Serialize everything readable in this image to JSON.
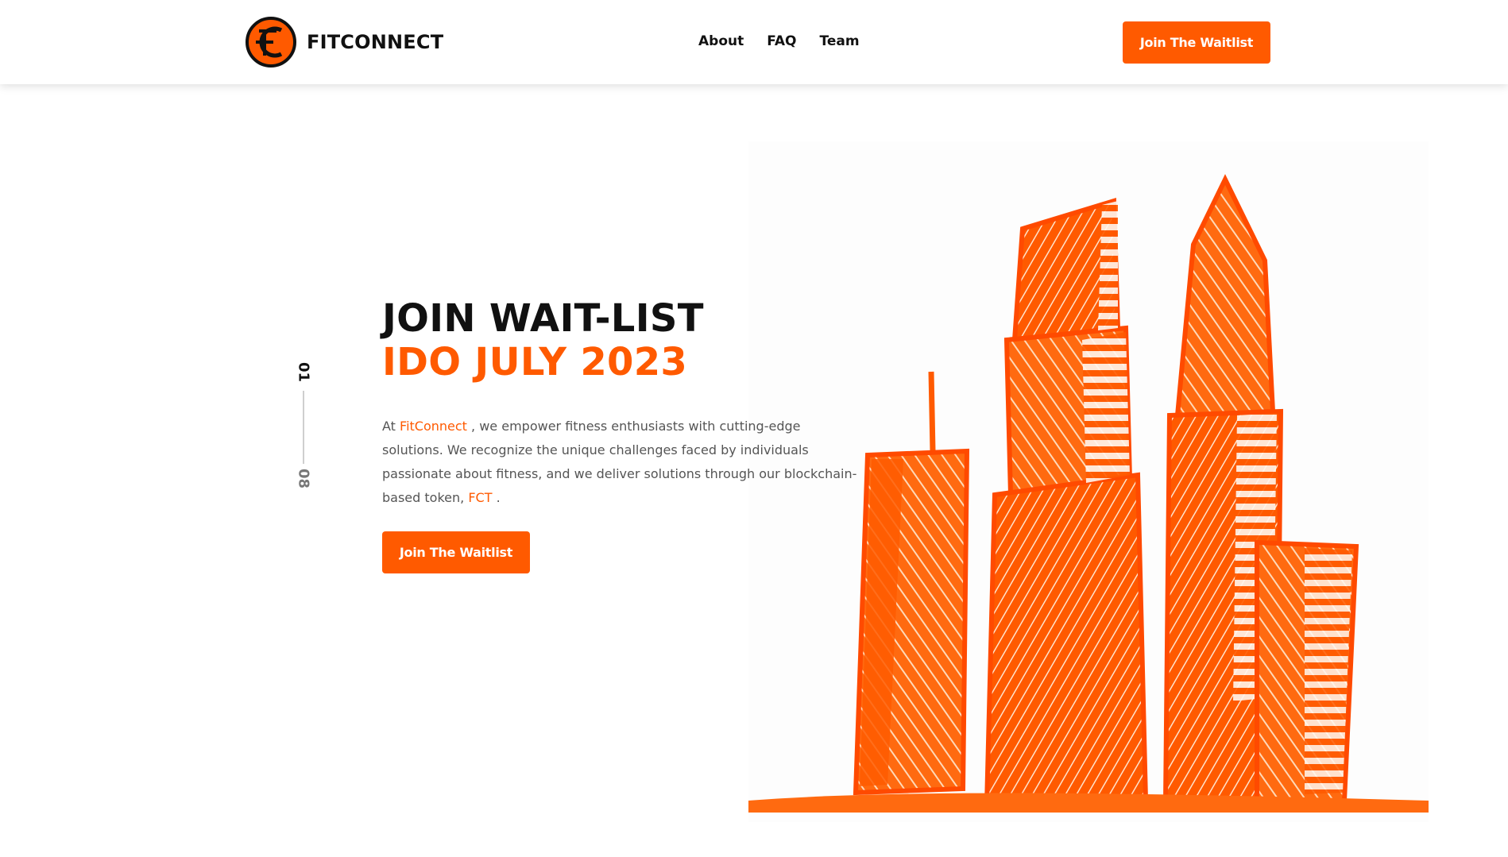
{
  "brand": {
    "logo_text": "FITCONNECT",
    "icon": "fc-logo-icon"
  },
  "nav": {
    "items": [
      {
        "label": "About"
      },
      {
        "label": "FAQ"
      },
      {
        "label": "Team"
      }
    ]
  },
  "header": {
    "cta_label": "Join The Waitlist"
  },
  "slider": {
    "current": "01",
    "total": "08"
  },
  "hero": {
    "title": "JOIN WAIT-LIST",
    "subtitle": "IDO JULY 2023",
    "description": {
      "prefix": "At",
      "brand_link": "FitConnect",
      "body": ", we empower fitness enthusiasts with cutting-edge solutions. We recognize the unique challenges faced by individuals passionate about fitness, and we deliver solutions through our blockchain-based token,",
      "token_link": "FCT",
      "suffix": "."
    },
    "cta_label": "Join The Waitlist",
    "image": "orange-crayon-skyscrapers-illustration"
  },
  "colors": {
    "accent": "#ff5a00",
    "text_dark": "#111111",
    "text_body": "#555555",
    "background": "#ffffff"
  }
}
